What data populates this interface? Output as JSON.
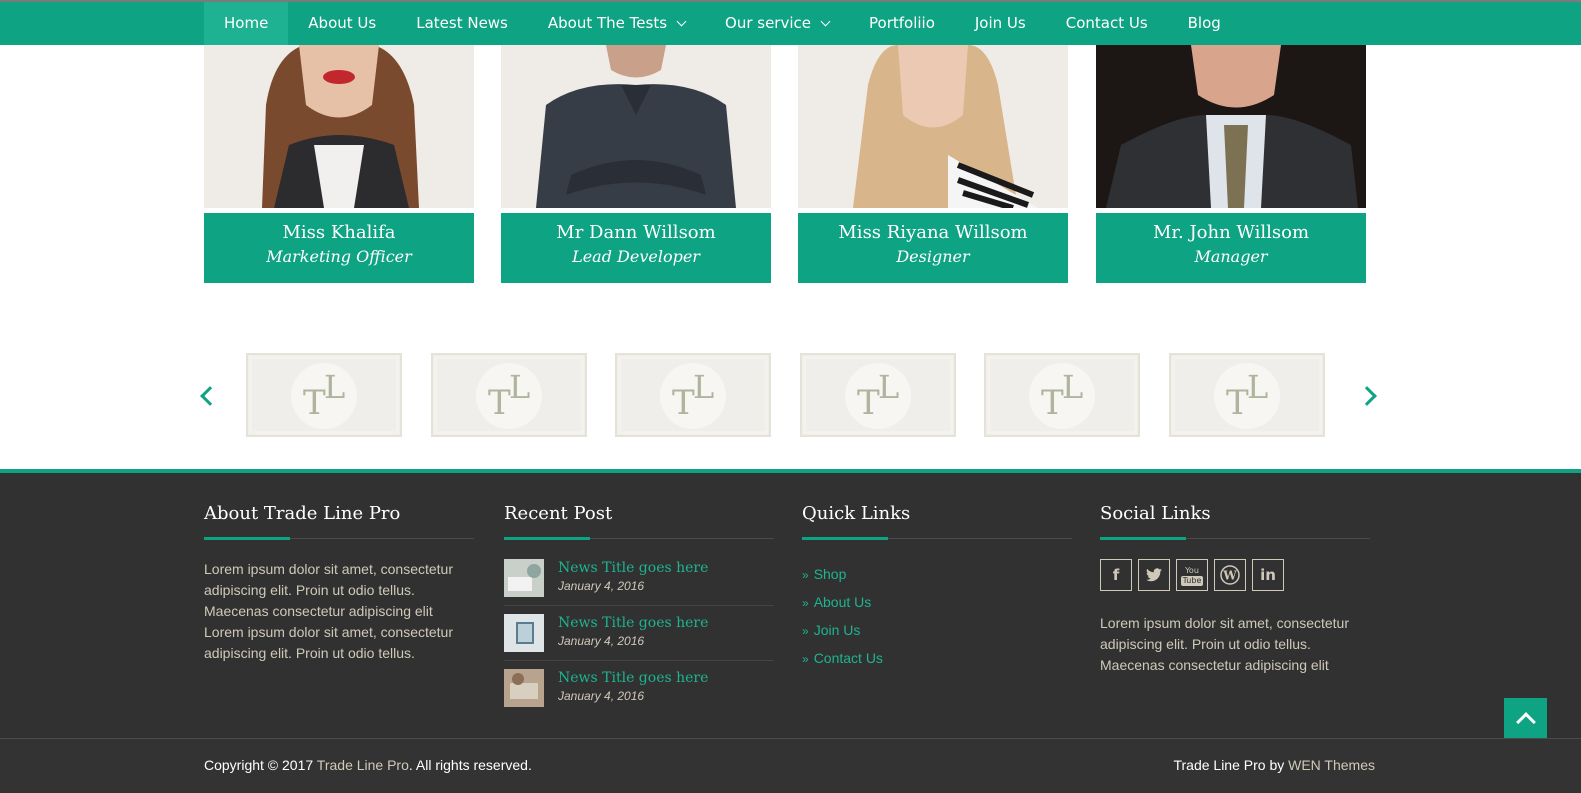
{
  "nav": {
    "items": [
      {
        "label": "Home",
        "active": true
      },
      {
        "label": "About Us"
      },
      {
        "label": "Latest News"
      },
      {
        "label": "About The Tests",
        "dropdown": true
      },
      {
        "label": "Our service",
        "dropdown": true
      },
      {
        "label": "Portfoliio"
      },
      {
        "label": "Join Us"
      },
      {
        "label": "Contact Us"
      },
      {
        "label": "Blog"
      }
    ]
  },
  "team": [
    {
      "name": "Miss Khalifa",
      "role": "Marketing Officer"
    },
    {
      "name": "Mr Dann Willsom",
      "role": "Lead Developer"
    },
    {
      "name": "Miss Riyana Willsom",
      "role": "Designer"
    },
    {
      "name": "Mr. John Willsom",
      "role": "Manager"
    }
  ],
  "clients": {
    "logo_letters": [
      "T",
      "L"
    ],
    "count": 6
  },
  "footer": {
    "about": {
      "title": "About Trade Line Pro",
      "text": "Lorem ipsum dolor sit amet, consectetur adipiscing elit. Proin ut odio tellus. Maecenas consectetur adipiscing elit Lorem ipsum dolor sit amet, consectetur adipiscing elit. Proin ut odio tellus."
    },
    "recent": {
      "title": "Recent Post",
      "posts": [
        {
          "title": "News Title goes here",
          "date": "January 4, 2016"
        },
        {
          "title": "News Title goes here",
          "date": "January 4, 2016"
        },
        {
          "title": "News Title goes here",
          "date": "January 4, 2016"
        }
      ]
    },
    "quick": {
      "title": "Quick Links",
      "links": [
        "Shop",
        "About Us",
        "Join Us",
        "Contact Us"
      ]
    },
    "social": {
      "title": "Social Links",
      "icons": [
        "facebook-icon",
        "twitter-icon",
        "youtube-icon",
        "wordpress-icon",
        "linkedin-icon"
      ],
      "text": "Lorem ipsum dolor sit amet, consectetur adipiscing elit. Proin ut odio tellus. Maecenas consectetur adipiscing elit"
    }
  },
  "bottom": {
    "copy_prefix": "Copyright © 2017 ",
    "copy_link": "Trade Line Pro",
    "copy_suffix": ". All rights reserved.",
    "credit_prefix": "Trade Line Pro by ",
    "credit_link": "WEN Themes"
  },
  "colors": {
    "accent": "#0ea383",
    "footer_bg": "#313131",
    "link": "#1db48f"
  }
}
